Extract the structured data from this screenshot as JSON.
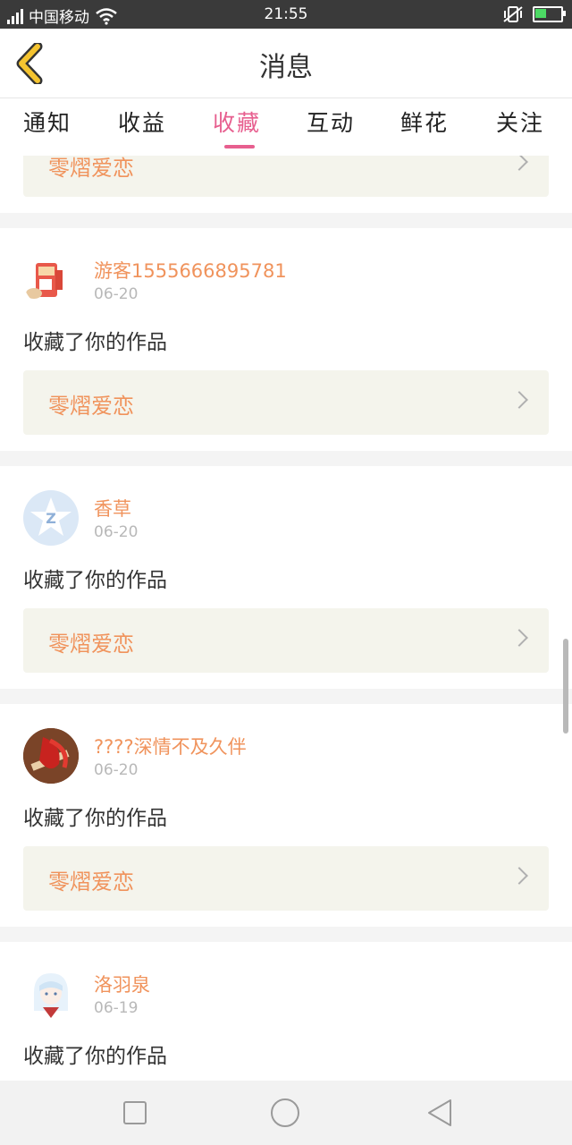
{
  "status_bar": {
    "carrier": "中国移动",
    "time": "21:55",
    "battery_level": 0.45
  },
  "header": {
    "title": "消息",
    "back_icon": "chevron-left-icon"
  },
  "tabs": [
    {
      "label": "通知"
    },
    {
      "label": "收益"
    },
    {
      "label": "收藏"
    },
    {
      "label": "互动"
    },
    {
      "label": "鲜花"
    },
    {
      "label": "关注"
    }
  ],
  "active_tab": "收藏",
  "feed": {
    "partial_work_title": "零熠爱恋",
    "items": [
      {
        "user": "游客1555666895781",
        "date": "06-20",
        "action": "收藏了你的作品",
        "work": "零熠爱恋"
      },
      {
        "user": "香草",
        "date": "06-20",
        "action": "收藏了你的作品",
        "work": "零熠爱恋"
      },
      {
        "user": "????深情不及久伴",
        "date": "06-20",
        "action": "收藏了你的作品",
        "work": "零熠爱恋"
      },
      {
        "user": "洛羽泉",
        "date": "06-19",
        "action": "收藏了你的作品"
      }
    ]
  },
  "colors": {
    "accent_pink": "#e75f8f",
    "username_orange": "#f0935c",
    "back_yellow": "#f5c430"
  }
}
